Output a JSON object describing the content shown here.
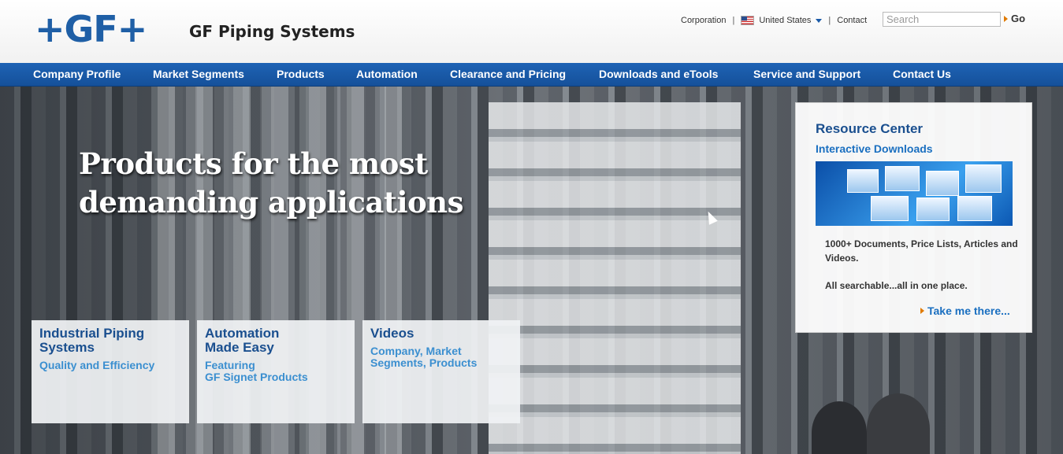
{
  "header": {
    "logo": "+GF+",
    "brand": "GF Piping Systems",
    "utility": {
      "corporation": "Corporation",
      "country": "United States",
      "contact": "Contact",
      "separator": "|"
    },
    "search": {
      "placeholder": "Search",
      "go_label": "Go"
    }
  },
  "nav": {
    "items": [
      {
        "label": "Company Profile"
      },
      {
        "label": "Market Segments"
      },
      {
        "label": "Products"
      },
      {
        "label": "Automation"
      },
      {
        "label": "Clearance and Pricing"
      },
      {
        "label": "Downloads and eTools"
      },
      {
        "label": "Service and Support"
      },
      {
        "label": "Contact Us"
      }
    ]
  },
  "hero": {
    "headline_line1": "Products for the most",
    "headline_line2": "demanding applications"
  },
  "tiles": [
    {
      "title": "Industrial Piping Systems",
      "subtitle": "Quality and Efficiency"
    },
    {
      "title_line1": "Automation",
      "title_line2": "Made Easy",
      "subtitle_line1": "Featuring",
      "subtitle_line2": "GF Signet Products"
    },
    {
      "title": "Videos",
      "subtitle_line1": "Company, Market",
      "subtitle_line2": "Segments, Products"
    }
  ],
  "resource_center": {
    "title": "Resource Center",
    "subtitle": "Interactive Downloads",
    "text1": "1000+ Documents, Price Lists, Articles and Videos.",
    "text2": "All searchable...all in one place.",
    "link": "Take me there..."
  },
  "colors": {
    "brand_blue": "#1f5fa6",
    "nav_blue": "#1a5aa8",
    "accent_orange": "#e07a00",
    "link_blue": "#1a6fc0"
  },
  "icons": [
    "flag-icon",
    "caret-down-icon",
    "arrow-right-icon",
    "cursor-icon"
  ]
}
